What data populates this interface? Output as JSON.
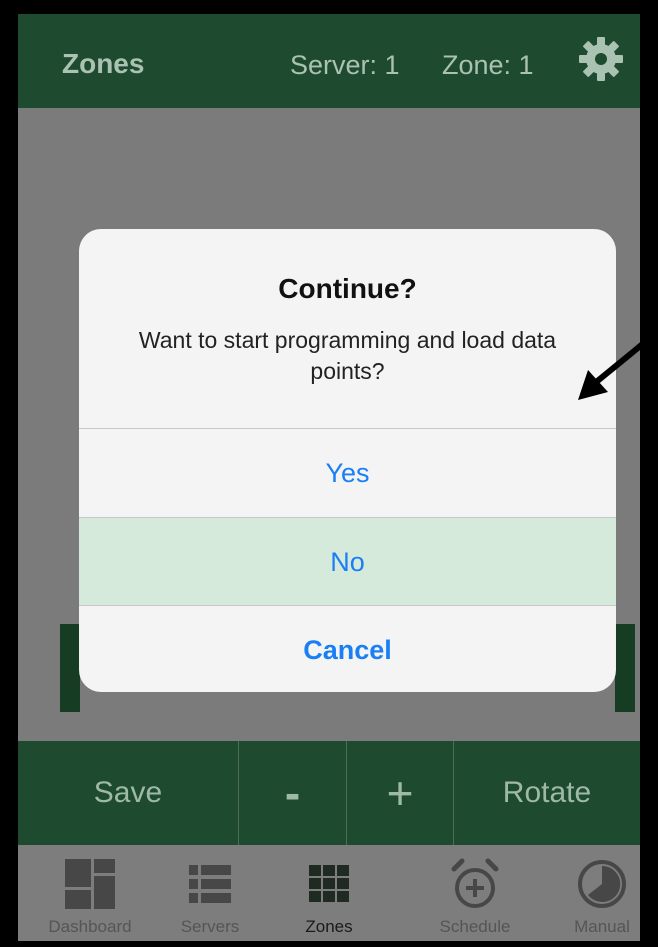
{
  "header": {
    "title": "Zones",
    "server_text": "Server: 1",
    "zone_text": "Zone: 1",
    "settings_icon": "gear-icon"
  },
  "actions": {
    "save_label": "Save",
    "minus_label": "-",
    "plus_label": "+",
    "rotate_label": "Rotate"
  },
  "tabs": [
    {
      "label": "Dashboard",
      "icon": "dashboard-icon"
    },
    {
      "label": "Servers",
      "icon": "servers-list-icon"
    },
    {
      "label": "Zones",
      "icon": "zones-grid-icon",
      "active": true
    },
    {
      "label": "Schedule",
      "icon": "alarm-clock-icon"
    },
    {
      "label": "Manual",
      "icon": "manual-dial-icon"
    }
  ],
  "dialog": {
    "title": "Continue?",
    "message": "Want to start programming and load data points?",
    "buttons": {
      "yes": "Yes",
      "no": "No",
      "cancel": "Cancel"
    }
  },
  "colors": {
    "header_green": "#1e4a2f",
    "ios_blue": "#1a7ff5"
  }
}
